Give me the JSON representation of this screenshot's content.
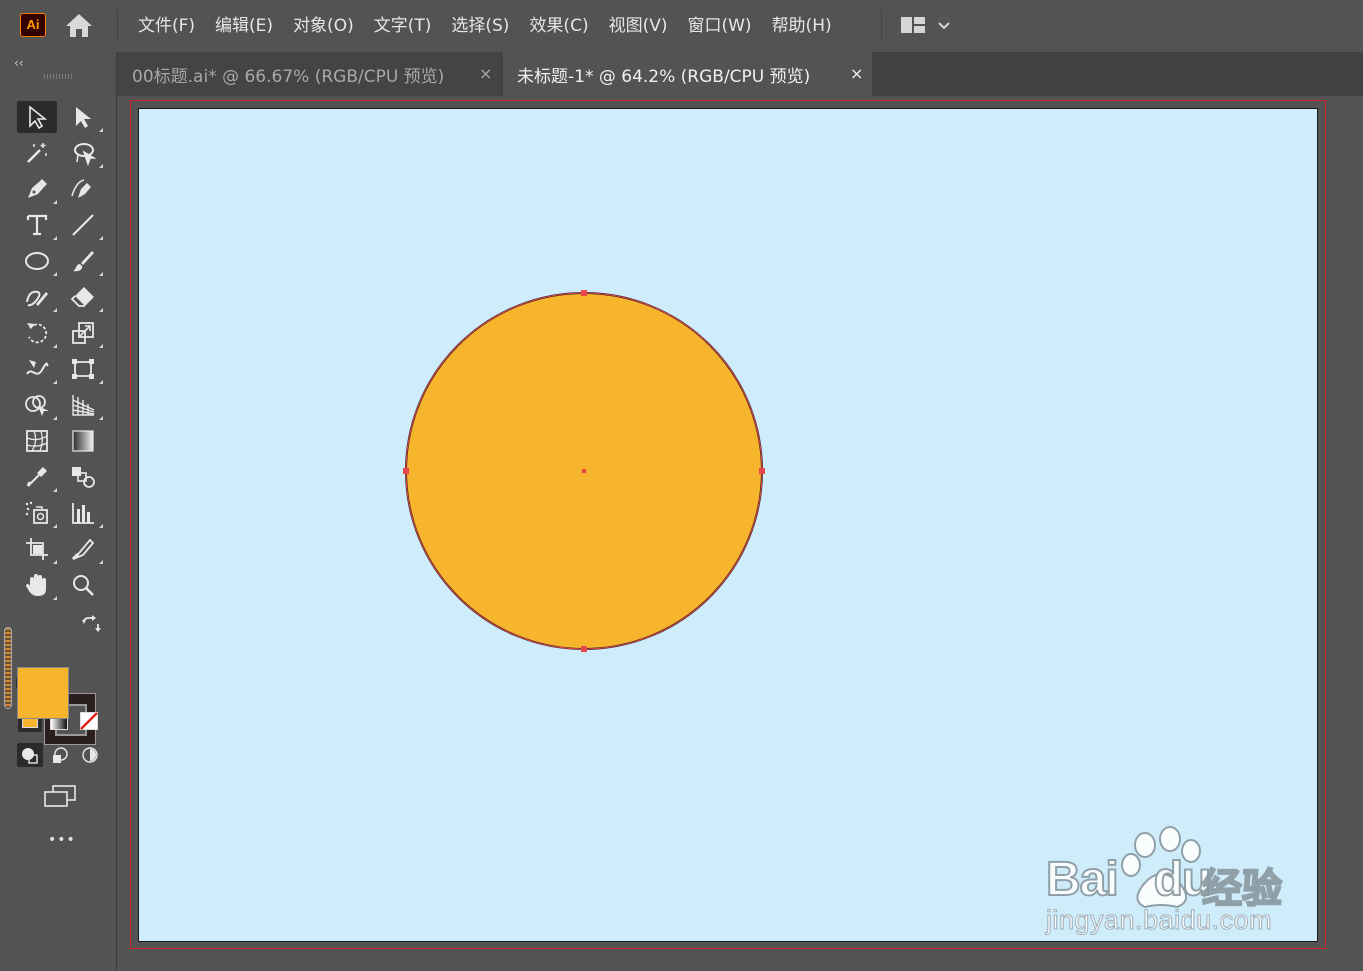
{
  "app": {
    "logo_text": "Ai",
    "menu": [
      "文件(F)",
      "编辑(E)",
      "对象(O)",
      "文字(T)",
      "选择(S)",
      "效果(C)",
      "视图(V)",
      "窗口(W)",
      "帮助(H)"
    ]
  },
  "tabs": [
    {
      "label": "00标题.ai* @ 66.67% (RGB/CPU 预览)",
      "active": false,
      "close": "×"
    },
    {
      "label": "未标题-1* @ 64.2% (RGB/CPU 预览)",
      "active": true,
      "close": "×"
    }
  ],
  "toolbar": {
    "collapse_label": "‹‹",
    "more_label": "•••",
    "fill_color": "#F7B52E",
    "stroke_color": "#2A1F1C",
    "tools": [
      "selection-tool",
      "direct-selection-tool",
      "magic-wand-tool",
      "lasso-tool",
      "pen-tool",
      "curvature-tool",
      "type-tool",
      "line-segment-tool",
      "ellipse-tool",
      "paintbrush-tool",
      "shaper-tool",
      "eraser-tool",
      "rotate-tool",
      "scale-tool",
      "warp-tool",
      "free-transform-tool",
      "shape-builder-tool",
      "perspective-grid-tool",
      "mesh-tool",
      "gradient-tool",
      "eyedropper-tool",
      "blend-tool",
      "symbol-sprayer-tool",
      "column-graph-tool",
      "artboard-tool",
      "slice-tool",
      "hand-tool",
      "zoom-tool"
    ]
  },
  "canvas": {
    "artboard_color": "#CFECFB",
    "circle_fill": "#F7B52E",
    "selection_color": "#E8474C"
  },
  "watermark": {
    "brand": "Bai",
    "brand2": "du",
    "cn": "经验",
    "url": "jingyan.baidu.com"
  }
}
